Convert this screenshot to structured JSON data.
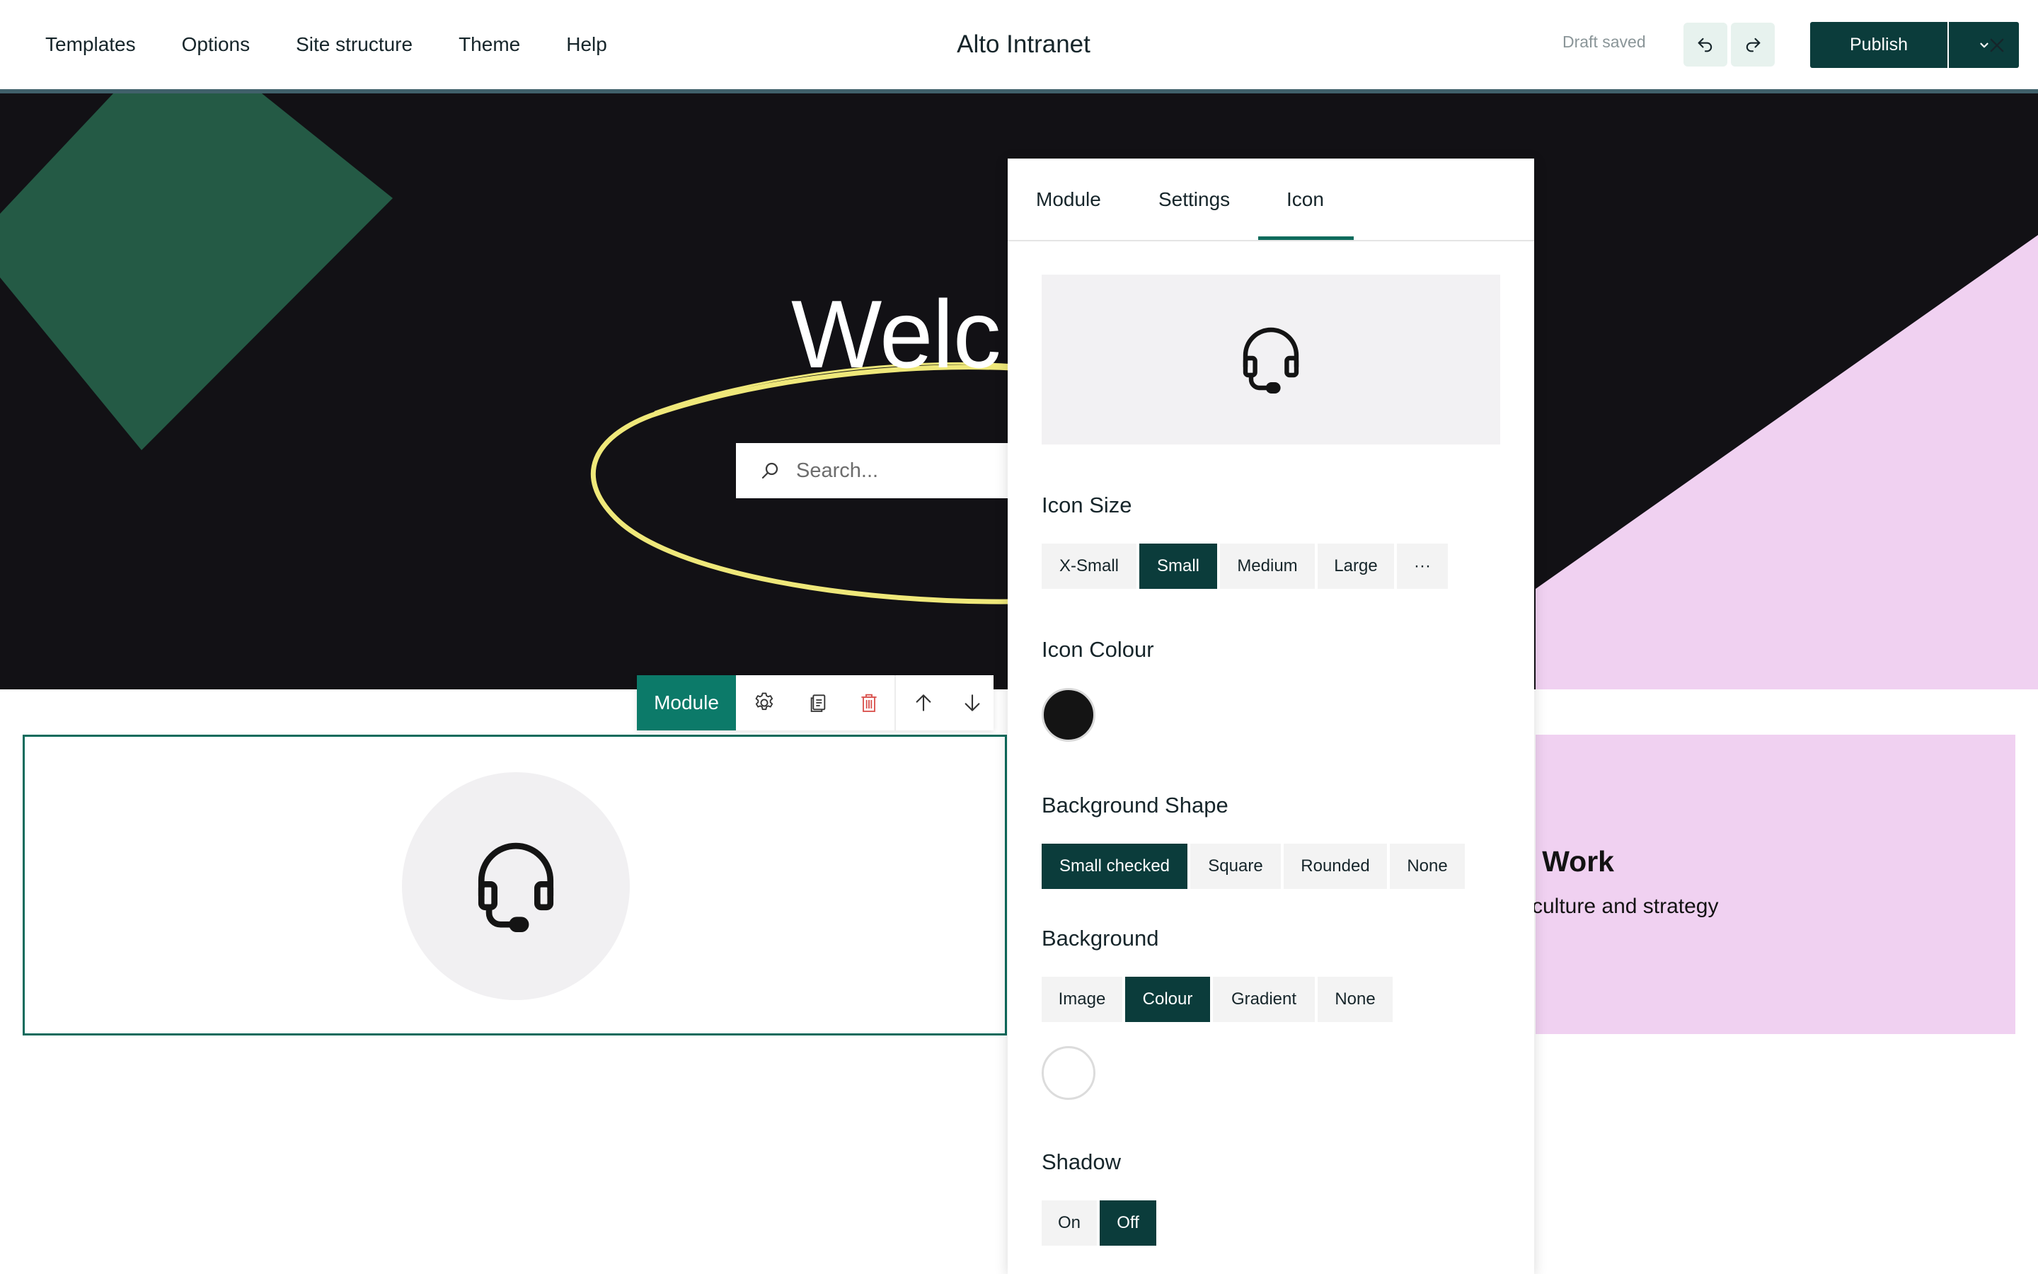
{
  "topbar": {
    "nav": [
      "Templates",
      "Options",
      "Site structure",
      "Theme",
      "Help"
    ],
    "title": "Alto Intranet",
    "draft_status": "Draft saved",
    "publish_label": "Publish"
  },
  "hero": {
    "title": "Welc",
    "search_placeholder": "Search..."
  },
  "module_toolbar": {
    "label": "Module"
  },
  "right_card": {
    "title": "e Work",
    "subtitle": "culture and strategy"
  },
  "panel": {
    "tabs": [
      "Module",
      "Settings",
      "Icon"
    ],
    "active_tab": "Icon",
    "icon_size": {
      "label": "Icon Size",
      "options": [
        "X-Small",
        "Small",
        "Medium",
        "Large",
        "···"
      ],
      "selected": "Small"
    },
    "icon_colour": {
      "label": "Icon Colour",
      "value": "#141414"
    },
    "background_shape": {
      "label": "Background Shape",
      "options": [
        "Small checked",
        "Square",
        "Rounded",
        "None"
      ],
      "selected": "Small checked"
    },
    "background": {
      "label": "Background",
      "options": [
        "Image",
        "Colour",
        "Gradient",
        "None"
      ],
      "selected": "Colour",
      "colour_value": "#ffffff"
    },
    "shadow": {
      "label": "Shadow",
      "options": [
        "On",
        "Off"
      ],
      "selected": "Off"
    }
  },
  "colors": {
    "accent": "#0c7a69",
    "dark_button": "#0b3c3b",
    "hero_bg": "#121115",
    "pink": "#f0d1f1",
    "green_shape": "#245a45",
    "ring": "#efe87a"
  }
}
